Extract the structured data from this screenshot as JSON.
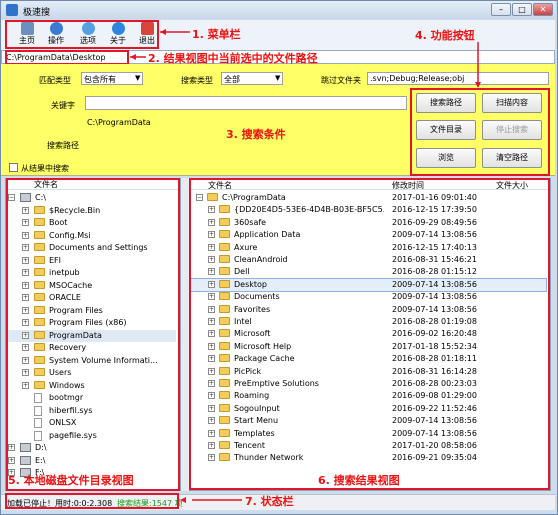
{
  "window": {
    "title": "极速搜",
    "controls": [
      "–",
      "□",
      "✕"
    ]
  },
  "toolbar": [
    {
      "label": "主页",
      "icon": "home-icon"
    },
    {
      "label": "操作",
      "icon": "operation-icon"
    },
    {
      "label": "选项",
      "icon": "options-icon"
    },
    {
      "label": "关于",
      "icon": "info-icon"
    },
    {
      "label": "退出",
      "icon": "exit-icon"
    }
  ],
  "path_bar": {
    "value": "C:\\ProgramData\\Desktop"
  },
  "conditions": {
    "match_type_label": "匹配类型",
    "match_type_value": "包含所有",
    "search_type_label": "搜索类型",
    "search_type_value": "全部",
    "skip_folders_label": "跳过文件夹",
    "skip_folders_value": ".svn;Debug;Release;obj",
    "keyword_label": "关键字",
    "keyword_value": "",
    "search_path_label": "搜索路径",
    "search_path_value": "C:\\ProgramData",
    "from_results_label": "从结果中搜索"
  },
  "buttons": {
    "search_path": "搜索路径",
    "scan_content": "扫描内容",
    "file_dir": "文件目录",
    "stop_search": "停止搜索",
    "browse": "浏览",
    "clear_path": "清空路径"
  },
  "tree": {
    "header": "文件名",
    "items": [
      {
        "name": "C:\\",
        "type": "drive"
      },
      {
        "name": "$Recycle.Bin",
        "type": "folder"
      },
      {
        "name": "Boot",
        "type": "folder"
      },
      {
        "name": "Config.Msi",
        "type": "folder"
      },
      {
        "name": "Documents and Settings",
        "type": "folder"
      },
      {
        "name": "EFI",
        "type": "folder"
      },
      {
        "name": "inetpub",
        "type": "folder"
      },
      {
        "name": "MSOCache",
        "type": "folder"
      },
      {
        "name": "ORACLE",
        "type": "folder"
      },
      {
        "name": "Program Files",
        "type": "folder"
      },
      {
        "name": "Program Files (x86)",
        "type": "folder"
      },
      {
        "name": "ProgramData",
        "type": "folder"
      },
      {
        "name": "Recovery",
        "type": "folder"
      },
      {
        "name": "System Volume Informati...",
        "type": "folder"
      },
      {
        "name": "Users",
        "type": "folder"
      },
      {
        "name": "Windows",
        "type": "folder"
      },
      {
        "name": "bootmgr",
        "type": "file"
      },
      {
        "name": "hiberfil.sys",
        "type": "file"
      },
      {
        "name": "ONLSX",
        "type": "file"
      },
      {
        "name": "pagefile.sys",
        "type": "file"
      },
      {
        "name": "D:\\",
        "type": "drive"
      },
      {
        "name": "E:\\",
        "type": "drive"
      },
      {
        "name": "F:\\",
        "type": "drive"
      }
    ]
  },
  "results": {
    "headers": [
      "文件名",
      "修改时间",
      "文件大小"
    ],
    "root": "C:\\ProgramData",
    "rows": [
      {
        "name": "{DD20E4D5-53E6-4D4B-B03E-BF5C5...",
        "time": "2016-12-15 17:39:50"
      },
      {
        "name": "360safe",
        "time": "2016-09-29 08:49:56"
      },
      {
        "name": "Application Data",
        "time": "2009-07-14 13:08:56"
      },
      {
        "name": "Axure",
        "time": "2016-12-15 17:40:13"
      },
      {
        "name": "CleanAndroid",
        "time": "2016-08-31 15:46:21"
      },
      {
        "name": "Dell",
        "time": "2016-08-28 01:15:12"
      },
      {
        "name": "Desktop",
        "time": "2009-07-14 13:08:56"
      },
      {
        "name": "Documents",
        "time": "2009-07-14 13:08:56"
      },
      {
        "name": "Favorites",
        "time": "2009-07-14 13:08:56"
      },
      {
        "name": "Intel",
        "time": "2016-08-28 01:19:08"
      },
      {
        "name": "Microsoft",
        "time": "2016-09-02 16:20:48"
      },
      {
        "name": "Microsoft Help",
        "time": "2017-01-18 15:52:34"
      },
      {
        "name": "Package Cache",
        "time": "2016-08-28 01:18:11"
      },
      {
        "name": "PicPick",
        "time": "2016-08-31 16:14:28"
      },
      {
        "name": "PreEmptive Solutions",
        "time": "2016-08-28 00:23:03"
      },
      {
        "name": "Roaming",
        "time": "2016-09-08 01:29:00"
      },
      {
        "name": "SogouInput",
        "time": "2016-09-22 11:52:46"
      },
      {
        "name": "Start Menu",
        "time": "2009-07-14 13:08:56"
      },
      {
        "name": "Templates",
        "time": "2009-07-14 13:08:56"
      },
      {
        "name": "Tencent",
        "time": "2017-01-20 08:58:06"
      },
      {
        "name": "Thunder Network",
        "time": "2016-09-21 09:35:04"
      }
    ],
    "root_time": "2017-01-16 09:01:40",
    "selected_index": 6
  },
  "status": {
    "left": "加载已停止！用时:0:0:2.308",
    "right": "搜索结果:1547 项"
  },
  "annotations": {
    "a1": "1. 菜单栏",
    "a2": "2. 结果视图中当前选中的文件路径",
    "a3": "3. 搜索条件",
    "a4": "4. 功能按钮",
    "a5": "5. 本地磁盘文件目录视图",
    "a6": "6. 搜索结果视图",
    "a7": "7. 状态栏"
  },
  "colors": {
    "condition_bg": "#ffff66",
    "annotation": "#e0162b",
    "status_green": "#1a9a1a"
  }
}
